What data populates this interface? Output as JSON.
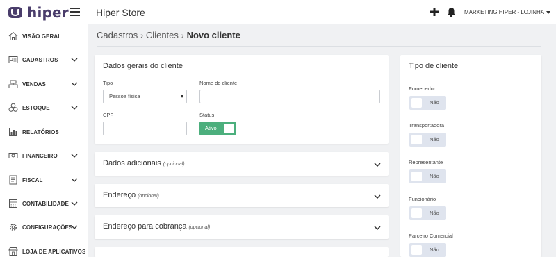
{
  "app": {
    "logo_text": "hiper",
    "store_title": "Hiper Store",
    "user_name": "MARKETING HIPER - LOJINHA"
  },
  "sidebar": {
    "items": [
      {
        "label": "VISÃO GERAL",
        "icon": "home-icon",
        "expandable": false
      },
      {
        "label": "CADASTROS",
        "icon": "id-card-icon",
        "expandable": true
      },
      {
        "label": "VENDAS",
        "icon": "cash-register-icon",
        "expandable": true
      },
      {
        "label": "ESTOQUE",
        "icon": "boxes-icon",
        "expandable": true
      },
      {
        "label": "RELATÓRIOS",
        "icon": "bar-chart-icon",
        "expandable": false
      },
      {
        "label": "FINANCEIRO",
        "icon": "money-icon",
        "expandable": true
      },
      {
        "label": "FISCAL",
        "icon": "document-icon",
        "expandable": true
      },
      {
        "label": "CONTABILIDADE",
        "icon": "calculator-icon",
        "expandable": true
      },
      {
        "label": "CONFIGURAÇÕES",
        "icon": "gear-icon",
        "expandable": true
      },
      {
        "label": "LOJA DE APLICATIVOS",
        "icon": "store-icon",
        "expandable": false
      }
    ]
  },
  "breadcrumb": {
    "level1": "Cadastros",
    "level2": "Clientes",
    "current": "Novo cliente"
  },
  "general": {
    "title": "Dados gerais do cliente",
    "tipo_label": "Tipo",
    "tipo_value": "Pessoa física",
    "nome_label": "Nome do cliente",
    "nome_value": "",
    "cpf_label": "CPF",
    "cpf_value": "",
    "status_label": "Status",
    "status_value": "Ativo"
  },
  "sections": [
    {
      "title": "Dados adicionais",
      "optional": "(opcional)"
    },
    {
      "title": "Endereço",
      "optional": "(opcional)"
    },
    {
      "title": "Endereço para cobrança",
      "optional": "(opcional)"
    }
  ],
  "client_type": {
    "title": "Tipo de cliente",
    "items": [
      {
        "label": "Fornecedor",
        "value": "Não"
      },
      {
        "label": "Transportadora",
        "value": "Não"
      },
      {
        "label": "Representante",
        "value": "Não"
      },
      {
        "label": "Funcionário",
        "value": "Não"
      },
      {
        "label": "Parceiro Comercial",
        "value": "Não"
      }
    ]
  },
  "colors": {
    "brand": "#4a3d6b",
    "active_toggle": "#4caf7d",
    "inactive_toggle": "#dfe4ee",
    "background": "#f0f1f3"
  }
}
